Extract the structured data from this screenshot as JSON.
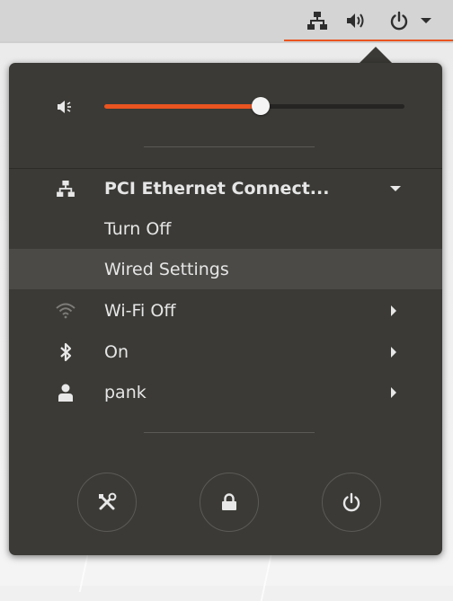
{
  "colors": {
    "accent": "#e95420",
    "menu_bg": "#3b3a36",
    "highlight": "#4b4a46"
  },
  "tray": {
    "icons": [
      "network-wired-icon",
      "volume-icon",
      "power-icon",
      "chevron-down-icon"
    ]
  },
  "volume": {
    "icon": "speaker-low-icon",
    "level": 0.52
  },
  "network": {
    "title": "PCI Ethernet Connect...",
    "submenu": {
      "turn_off": "Turn Off",
      "wired_settings": "Wired Settings"
    }
  },
  "items": {
    "wifi": "Wi-Fi Off",
    "bluetooth": "On",
    "user": "pank"
  },
  "actions": {
    "settings": "settings-icon",
    "lock": "lock-icon",
    "power": "power-icon"
  }
}
